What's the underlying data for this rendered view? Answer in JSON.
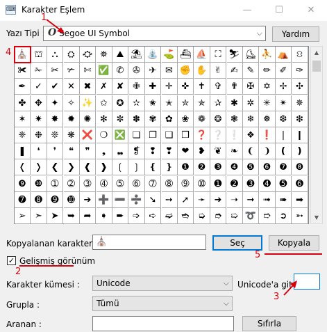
{
  "window": {
    "title": "Karakter Eşlem"
  },
  "font": {
    "label": "Yazı Tipi :",
    "icon_glyph": "O",
    "selected": "Segoe UI Symbol"
  },
  "help_button": "Yardım",
  "character_grid": {
    "rows": [
      [
        "⛪",
        "⛫",
        "⛬",
        "⛭",
        "⛮",
        "⛯",
        "⛰",
        "⛱",
        "⛲",
        "⛳",
        "⛴",
        "⛵",
        "⛶",
        "⛷",
        "⛸",
        "⛹",
        "⛺",
        "⛻"
      ],
      [
        "✀",
        "✁",
        "✂",
        "✃",
        "✄",
        "✅",
        "✆",
        "✇",
        "✈",
        "✉",
        "✊",
        "✋",
        "✌",
        "✍",
        "✎",
        "✏",
        "✐",
        "✑"
      ],
      [
        "✒",
        "✓",
        "✔",
        "✕",
        "✖",
        "✗",
        "✘",
        "✙",
        "✚",
        "✛",
        "✜",
        "✝",
        "✞",
        "✟",
        "✠",
        "✡",
        "✢",
        "✣"
      ],
      [
        "✤",
        "✥",
        "✦",
        "✧",
        "✨",
        "✩",
        "✪",
        "✫",
        "✬",
        "✭",
        "✮",
        "✯",
        "✰",
        "✱",
        "✲",
        "✳",
        "✴",
        "✵"
      ],
      [
        "✶",
        "✷",
        "✸",
        "✹",
        "✺",
        "✻",
        "✼",
        "✽",
        "✾",
        "✿",
        "❀",
        "❁",
        "❂",
        "❃",
        "❄",
        "❅",
        "❆",
        "❇"
      ],
      [
        "❈",
        "❉",
        "❊",
        "❋",
        "❌",
        "❍",
        "❎",
        "❏",
        "❐",
        "❑",
        "❒",
        "❓",
        "❔",
        "❕",
        "❖",
        "❗",
        "❘",
        "❙"
      ],
      [
        "❚",
        "❛",
        "❜",
        "❝",
        "❞",
        "❟",
        "❠",
        "❡",
        "❢",
        "❣",
        "❤",
        "❥",
        "❦",
        "❧",
        "❨",
        "❩",
        "❪",
        "❫"
      ],
      [
        "❬",
        "❭",
        "❮",
        "❯",
        "❰",
        "❱",
        "❲",
        "❳",
        "❴",
        "❵",
        "❶",
        "❷",
        "❸",
        "❹",
        "❺",
        "❻",
        "❼",
        "❽"
      ],
      [
        "❾",
        "❿",
        "➀",
        "➁",
        "➂",
        "➃",
        "➄",
        "➅",
        "➆",
        "➇",
        "➈",
        "➉",
        "➊",
        "➋",
        "➌",
        "➍",
        "➎",
        "➏"
      ],
      [
        "➐",
        "➑",
        "➒",
        "➓",
        "➔",
        "➕",
        "➖",
        "➗",
        "➘",
        "➙",
        "➚",
        "➛",
        "➜",
        "➝",
        "➞",
        "➟",
        "➠",
        "➡"
      ],
      [
        "➢",
        "➣",
        "➤",
        "➥",
        "➦",
        "➧",
        "➨",
        "➩",
        "➪",
        "➫",
        "➬",
        "➭",
        "➮",
        "➯",
        "➰",
        "➱",
        "➲",
        "➳"
      ]
    ]
  },
  "copy_row": {
    "label": "Kopyalanan karakterler :",
    "value": "⛪",
    "select_button": "Seç",
    "copy_button": "Kopyala"
  },
  "advanced": {
    "label": "Gelişmiş görünüm",
    "checked": "✓"
  },
  "charset": {
    "label": "Karakter kümesi :",
    "value": "Unicode"
  },
  "goto_unicode": {
    "label": "Unicode'a git :",
    "value": ""
  },
  "group": {
    "label": "Grupla :",
    "value": "Tümü"
  },
  "search": {
    "label": "Aranan :",
    "value": "",
    "reset_button": "Sıfırla"
  },
  "annotations": {
    "n1": "1",
    "n2": "2",
    "n3": "3",
    "n4": "4",
    "n5": "5"
  },
  "colors": {
    "annotation": "#d8000c",
    "focus": "#0078d7"
  }
}
